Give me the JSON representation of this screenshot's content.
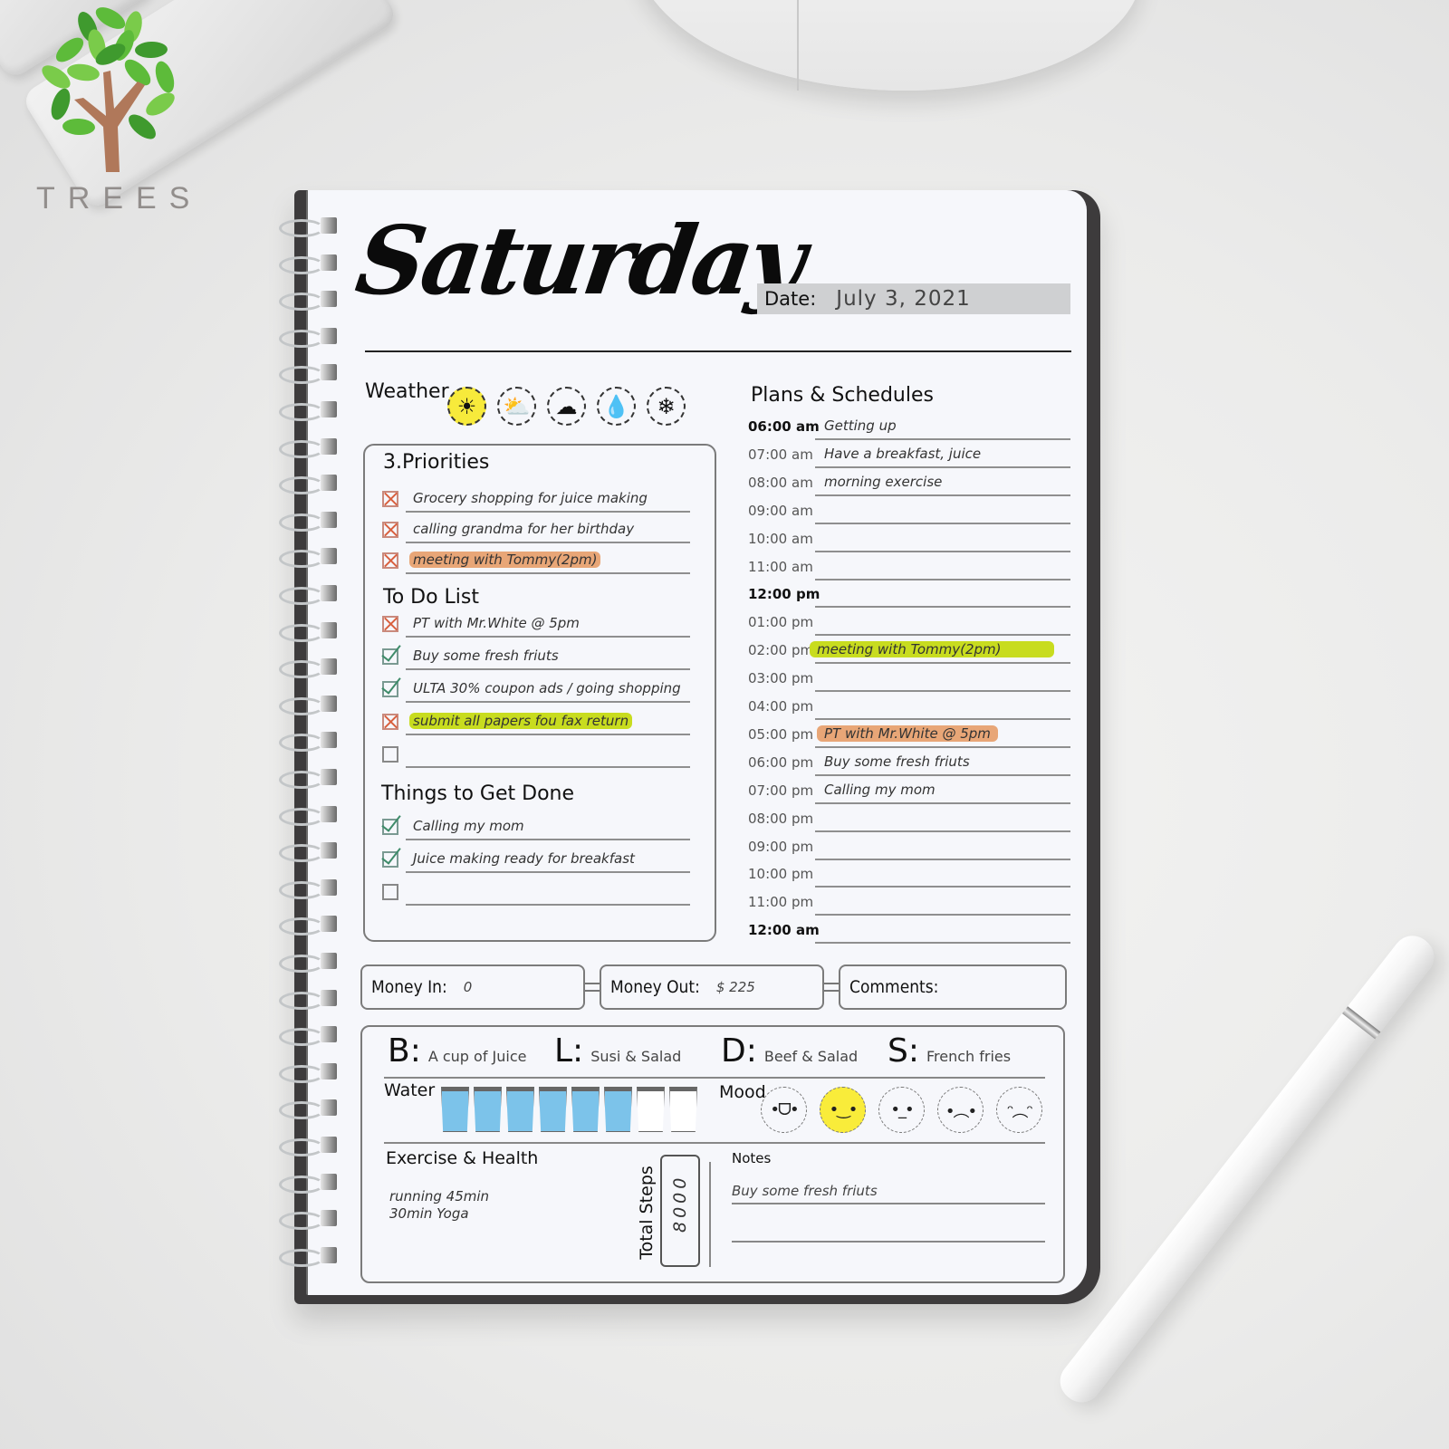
{
  "brand": {
    "logo_text": "TREES",
    "leaf_color": "#5dbb3a",
    "trunk_color": "#b0785a"
  },
  "page": {
    "title": "Saturday",
    "date_label": "Date:",
    "date_value": "July 3, 2021"
  },
  "weather": {
    "label": "Weather",
    "icons": [
      {
        "name": "sun-icon",
        "glyph": "☀",
        "selected": true
      },
      {
        "name": "partly-cloudy-icon",
        "glyph": "⛅",
        "selected": false
      },
      {
        "name": "cloud-icon",
        "glyph": "☁",
        "selected": false
      },
      {
        "name": "rain-drop-icon",
        "glyph": "💧",
        "selected": false
      },
      {
        "name": "snowflake-icon",
        "glyph": "❄",
        "selected": false
      }
    ],
    "highlight_color": "#f7ea3b"
  },
  "priorities": {
    "title": "3.Priorities",
    "items": [
      {
        "text": "Grocery shopping for juice making",
        "state": "x",
        "highlight": ""
      },
      {
        "text": "calling grandma for her birthday",
        "state": "x",
        "highlight": ""
      },
      {
        "text": "meeting with Tommy(2pm)",
        "state": "x",
        "highlight": "orange"
      }
    ]
  },
  "todo": {
    "title": "To  Do  List",
    "items": [
      {
        "text": "PT with Mr.White @ 5pm",
        "state": "x",
        "highlight": ""
      },
      {
        "text": "Buy some fresh friuts",
        "state": "check",
        "highlight": ""
      },
      {
        "text": "ULTA 30% coupon ads / going shopping",
        "state": "check",
        "highlight": ""
      },
      {
        "text": "submit all papers fou fax return",
        "state": "x",
        "highlight": "green"
      },
      {
        "text": "",
        "state": "empty",
        "highlight": ""
      }
    ]
  },
  "things": {
    "title": "Things  to  Get  Done",
    "items": [
      {
        "text": "Calling my mom",
        "state": "check",
        "highlight": ""
      },
      {
        "text": "Juice making ready for breakfast",
        "state": "check",
        "highlight": ""
      },
      {
        "text": "",
        "state": "empty",
        "highlight": ""
      }
    ]
  },
  "schedule": {
    "title": "Plans  &  Schedules",
    "rows": [
      {
        "time": "06:00 am",
        "text": "Getting up",
        "bold": true,
        "highlight": ""
      },
      {
        "time": "07:00 am",
        "text": "Have a breakfast, juice",
        "bold": false,
        "highlight": ""
      },
      {
        "time": "08:00 am",
        "text": "morning exercise",
        "bold": false,
        "highlight": ""
      },
      {
        "time": "09:00 am",
        "text": "",
        "bold": false,
        "highlight": ""
      },
      {
        "time": "10:00 am",
        "text": "",
        "bold": false,
        "highlight": ""
      },
      {
        "time": "11:00 am",
        "text": "",
        "bold": false,
        "highlight": ""
      },
      {
        "time": "12:00 pm",
        "text": "",
        "bold": true,
        "highlight": ""
      },
      {
        "time": "01:00 pm",
        "text": "",
        "bold": false,
        "highlight": ""
      },
      {
        "time": "02:00 pm",
        "text": "meeting with Tommy(2pm)",
        "bold": false,
        "highlight": "green"
      },
      {
        "time": "03:00 pm",
        "text": "",
        "bold": false,
        "highlight": ""
      },
      {
        "time": "04:00 pm",
        "text": "",
        "bold": false,
        "highlight": ""
      },
      {
        "time": "05:00 pm",
        "text": "PT with Mr.White @ 5pm",
        "bold": false,
        "highlight": "orange"
      },
      {
        "time": "06:00 pm",
        "text": "Buy some fresh friuts",
        "bold": false,
        "highlight": ""
      },
      {
        "time": "07:00 pm",
        "text": "Calling my mom",
        "bold": false,
        "highlight": ""
      },
      {
        "time": "08:00 pm",
        "text": "",
        "bold": false,
        "highlight": ""
      },
      {
        "time": "09:00 pm",
        "text": "",
        "bold": false,
        "highlight": ""
      },
      {
        "time": "10:00 pm",
        "text": "",
        "bold": false,
        "highlight": ""
      },
      {
        "time": "11:00 pm",
        "text": "",
        "bold": false,
        "highlight": ""
      },
      {
        "time": "12:00 am",
        "text": "",
        "bold": true,
        "highlight": ""
      }
    ]
  },
  "money": {
    "in_label": "Money In:",
    "in_value": "0",
    "out_label": "Money Out:",
    "out_value": "$ 225",
    "comments_label": "Comments:",
    "comments_value": ""
  },
  "meals": [
    {
      "key": "B:",
      "value": "A cup of Juice"
    },
    {
      "key": "L:",
      "value": "Susi & Salad"
    },
    {
      "key": "D:",
      "value": "Beef & Salad"
    },
    {
      "key": "S:",
      "value": "French fries"
    }
  ],
  "water": {
    "label": "Water",
    "filled": 6,
    "total": 8,
    "fill_color": "#7cc3ea"
  },
  "mood": {
    "label": "Mood",
    "faces": [
      {
        "name": "laughing-face-icon",
        "glyph": "•ᗜ•",
        "selected": false
      },
      {
        "name": "smiling-face-icon",
        "glyph": "•‿•",
        "selected": true
      },
      {
        "name": "neutral-face-icon",
        "glyph": "•_•",
        "selected": false
      },
      {
        "name": "sad-face-icon",
        "glyph": "•︵•",
        "selected": false
      },
      {
        "name": "angry-face-icon",
        "glyph": "ᵔ︵ᵔ",
        "selected": false
      }
    ],
    "highlight_color": "#f9ec3a"
  },
  "exercise": {
    "title": "Exercise & Health",
    "lines": [
      "running 45min",
      "30min Yoga"
    ]
  },
  "steps": {
    "label": "Total Steps",
    "value": "8000"
  },
  "notes": {
    "label": "Notes",
    "lines": [
      "Buy some fresh friuts",
      ""
    ]
  }
}
